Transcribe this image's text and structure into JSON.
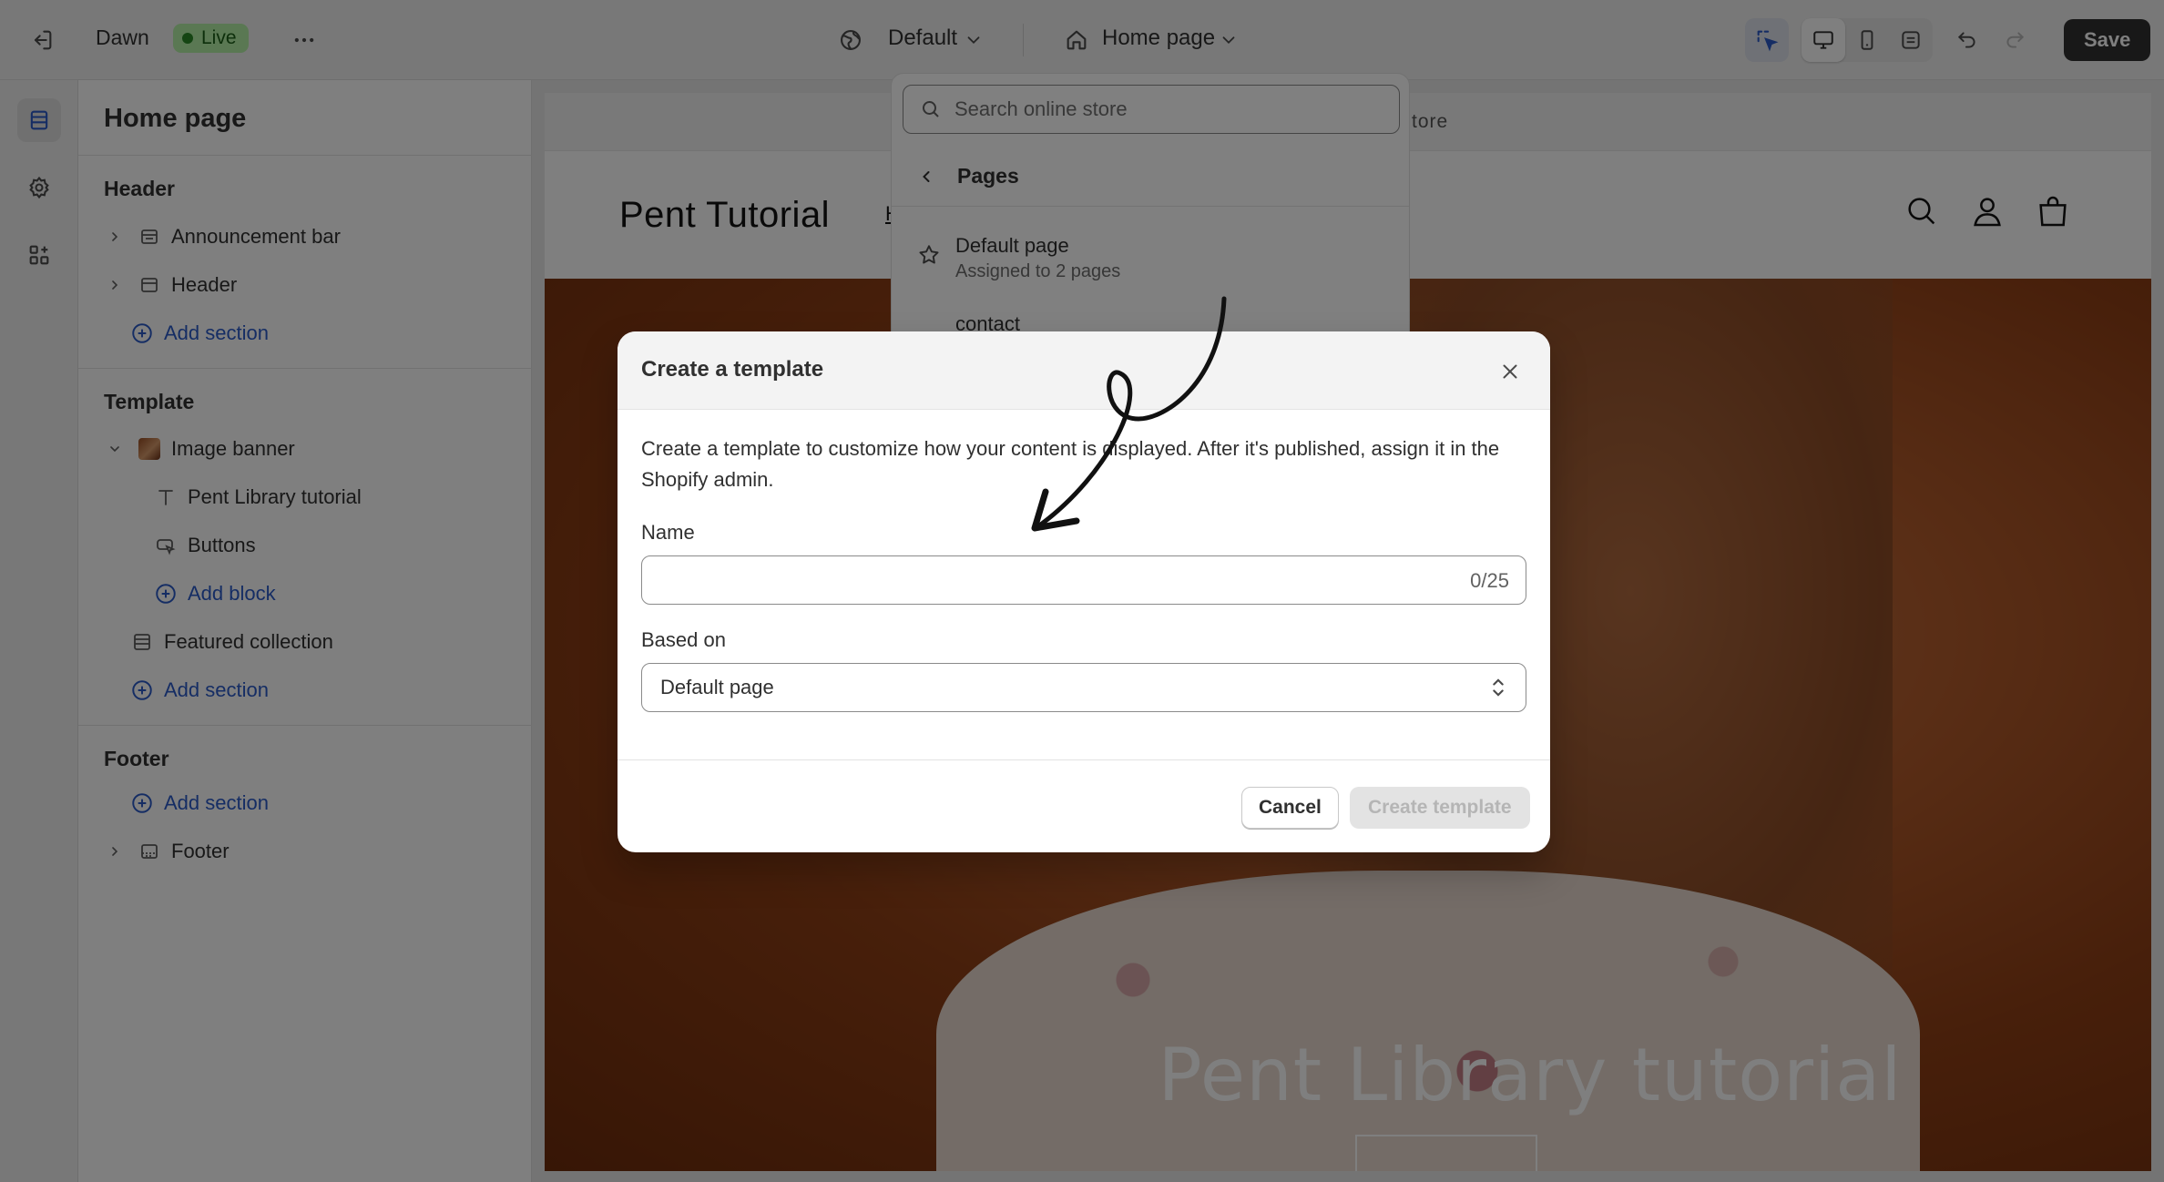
{
  "topbar": {
    "theme_name": "Dawn",
    "status": "Live",
    "locale": "Default",
    "page": "Home page",
    "save_label": "Save"
  },
  "sidebar": {
    "title": "Home page",
    "header_group": "Header",
    "header_items": [
      "Announcement bar",
      "Header"
    ],
    "add_section": "Add section",
    "template_group": "Template",
    "image_banner": "Image banner",
    "banner_blocks": [
      "Pent Library tutorial",
      "Buttons"
    ],
    "add_block": "Add block",
    "featured_collection": "Featured collection",
    "footer_group": "Footer",
    "footer_item": "Footer"
  },
  "preview": {
    "announcement": "tore",
    "logo": "Pent Tutorial",
    "nav_fragment": "H",
    "banner_title": "Pent Library tutorial"
  },
  "dropdown": {
    "search_placeholder": "Search online store",
    "back_label": "Pages",
    "items": [
      {
        "title": "Default page",
        "subtitle": "Assigned to 2 pages"
      },
      {
        "title": "contact"
      }
    ]
  },
  "modal": {
    "title": "Create a template",
    "description": "Create a template to customize how your content is displayed. After it's published, assign it in the Shopify admin.",
    "name_label": "Name",
    "name_value": "",
    "name_counter": "0/25",
    "based_on_label": "Based on",
    "based_on_value": "Default page",
    "cancel_label": "Cancel",
    "create_label": "Create template"
  },
  "colors": {
    "accent_link": "#2b5ac9",
    "live_badge": "#b4f0a6",
    "save_button": "#303030",
    "banner": "#b25b2b"
  },
  "icons": [
    "exit-icon",
    "more-icon",
    "globe-icon",
    "home-icon",
    "chevron-down-icon",
    "inspector-icon",
    "desktop-icon",
    "mobile-icon",
    "fullscreen-icon",
    "undo-icon",
    "redo-icon",
    "sections-icon",
    "settings-icon",
    "apps-icon",
    "search-icon",
    "user-icon",
    "cart-icon",
    "star-icon",
    "close-icon",
    "select-arrows-icon"
  ]
}
